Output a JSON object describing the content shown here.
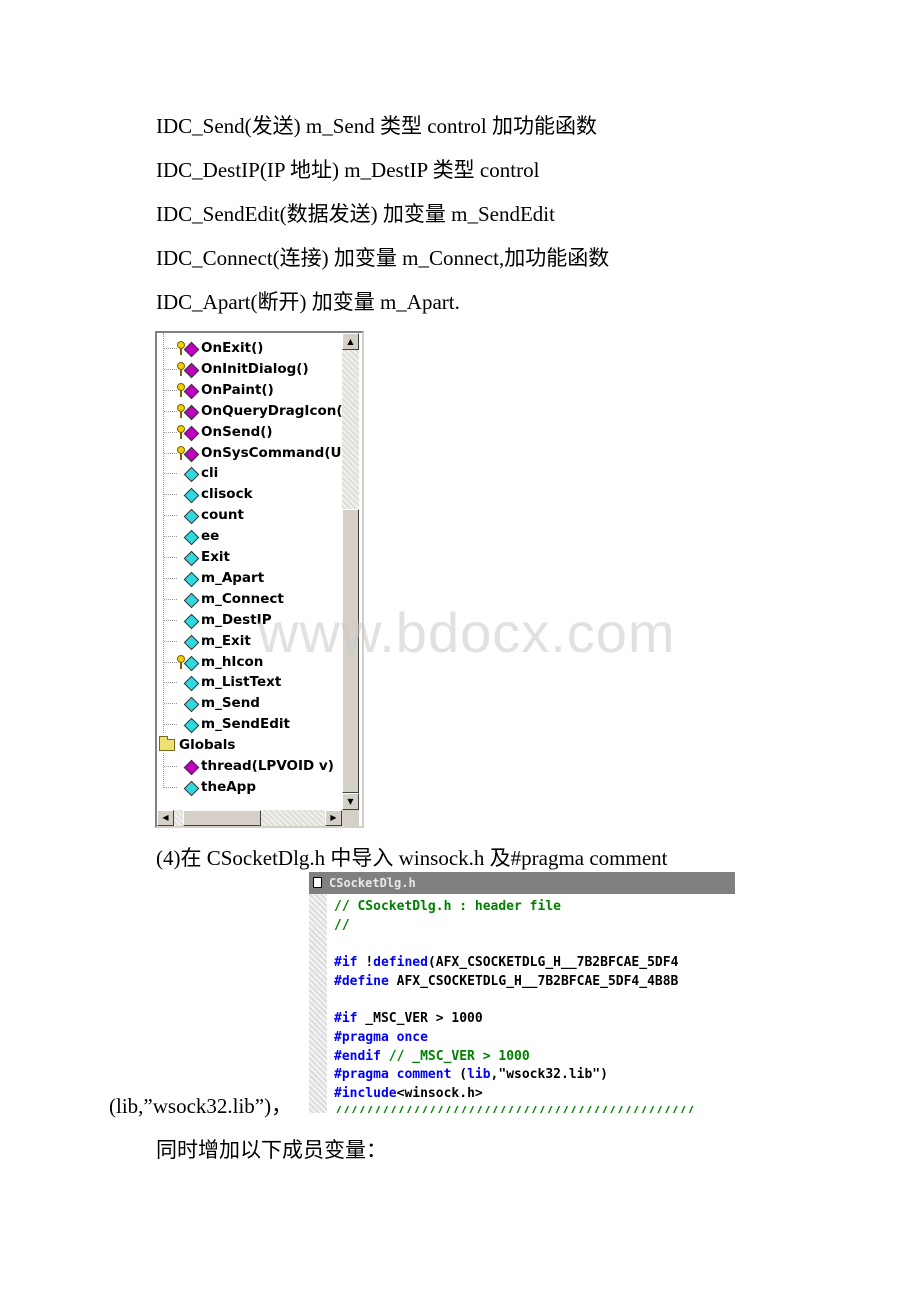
{
  "document": {
    "paragraphs": [
      "IDC_Send(发送) m_Send 类型 control 加功能函数",
      "IDC_DestIP(IP 地址) m_DestIP 类型 control",
      "IDC_SendEdit(数据发送) 加变量 m_SendEdit",
      "IDC_Connect(连接) 加变量 m_Connect,加功能函数",
      "IDC_Apart(断开) 加变量 m_Apart."
    ],
    "step4_text": "(4)在 CSocketDlg.h 中导入 winsock.h 及#pragma comment",
    "step4_continuation": "(lib,”wsock32.lib”)，",
    "after_text": "同时增加以下成员变量：",
    "watermark": "www.bdocx.com"
  },
  "class_view": {
    "members": [
      {
        "label": "OnExit()",
        "kind": "protected-method"
      },
      {
        "label": "OnInitDialog()",
        "kind": "protected-method"
      },
      {
        "label": "OnPaint()",
        "kind": "protected-method"
      },
      {
        "label": "OnQueryDragIcon(",
        "kind": "protected-method"
      },
      {
        "label": "OnSend()",
        "kind": "protected-method"
      },
      {
        "label": "OnSysCommand(U",
        "kind": "protected-method"
      },
      {
        "label": "cli",
        "kind": "variable"
      },
      {
        "label": "clisock",
        "kind": "variable"
      },
      {
        "label": "count",
        "kind": "variable"
      },
      {
        "label": "ee",
        "kind": "variable"
      },
      {
        "label": "Exit",
        "kind": "variable"
      },
      {
        "label": "m_Apart",
        "kind": "variable"
      },
      {
        "label": "m_Connect",
        "kind": "variable"
      },
      {
        "label": "m_DestIP",
        "kind": "variable"
      },
      {
        "label": "m_Exit",
        "kind": "variable"
      },
      {
        "label": "m_hIcon",
        "kind": "protected-variable"
      },
      {
        "label": "m_ListText",
        "kind": "variable"
      },
      {
        "label": "m_Send",
        "kind": "variable"
      },
      {
        "label": "m_SendEdit",
        "kind": "variable"
      }
    ],
    "globals_folder": "Globals",
    "globals": [
      {
        "label": "thread(LPVOID v)",
        "kind": "function"
      },
      {
        "label": "theApp",
        "kind": "variable"
      }
    ],
    "scroll_up_glyph": "▲",
    "scroll_down_glyph": "▼",
    "scroll_left_glyph": "◀",
    "scroll_right_glyph": "▶"
  },
  "code_window": {
    "title": "CSocketDlg.h",
    "lines": [
      [
        {
          "t": "// CSocketDlg.h : header file",
          "c": "cm"
        }
      ],
      [
        {
          "t": "//",
          "c": "cm"
        }
      ],
      [],
      [
        {
          "t": "#if ",
          "c": "kw"
        },
        {
          "t": "!",
          "c": "tx"
        },
        {
          "t": "defined",
          "c": "kw"
        },
        {
          "t": "(AFX_CSOCKETDLG_H__7B2BFCAE_5DF4",
          "c": "tx"
        }
      ],
      [
        {
          "t": "#define",
          "c": "kw"
        },
        {
          "t": " AFX_CSOCKETDLG_H__7B2BFCAE_5DF4_4B8B",
          "c": "tx"
        }
      ],
      [],
      [
        {
          "t": "#if",
          "c": "kw"
        },
        {
          "t": " _MSC_VER > 1000",
          "c": "tx"
        }
      ],
      [
        {
          "t": "#pragma once",
          "c": "kw"
        }
      ],
      [
        {
          "t": "#endif",
          "c": "kw"
        },
        {
          "t": " // _MSC_VER > 1000",
          "c": "cm"
        }
      ],
      [
        {
          "t": "#pragma comment",
          "c": "kw"
        },
        {
          "t": " (",
          "c": "tx"
        },
        {
          "t": "lib",
          "c": "kw"
        },
        {
          "t": ",\"wsock32.lib\")",
          "c": "tx"
        }
      ],
      [
        {
          "t": "#include",
          "c": "kw"
        },
        {
          "t": "<winsock.h>",
          "c": "tx"
        }
      ],
      [
        {
          "t": "//////////////////////////////////////////////",
          "c": "cm"
        }
      ]
    ]
  },
  "colors": {
    "keyword": "#0000ff",
    "comment": "#008000",
    "title_bar": "#808080"
  }
}
